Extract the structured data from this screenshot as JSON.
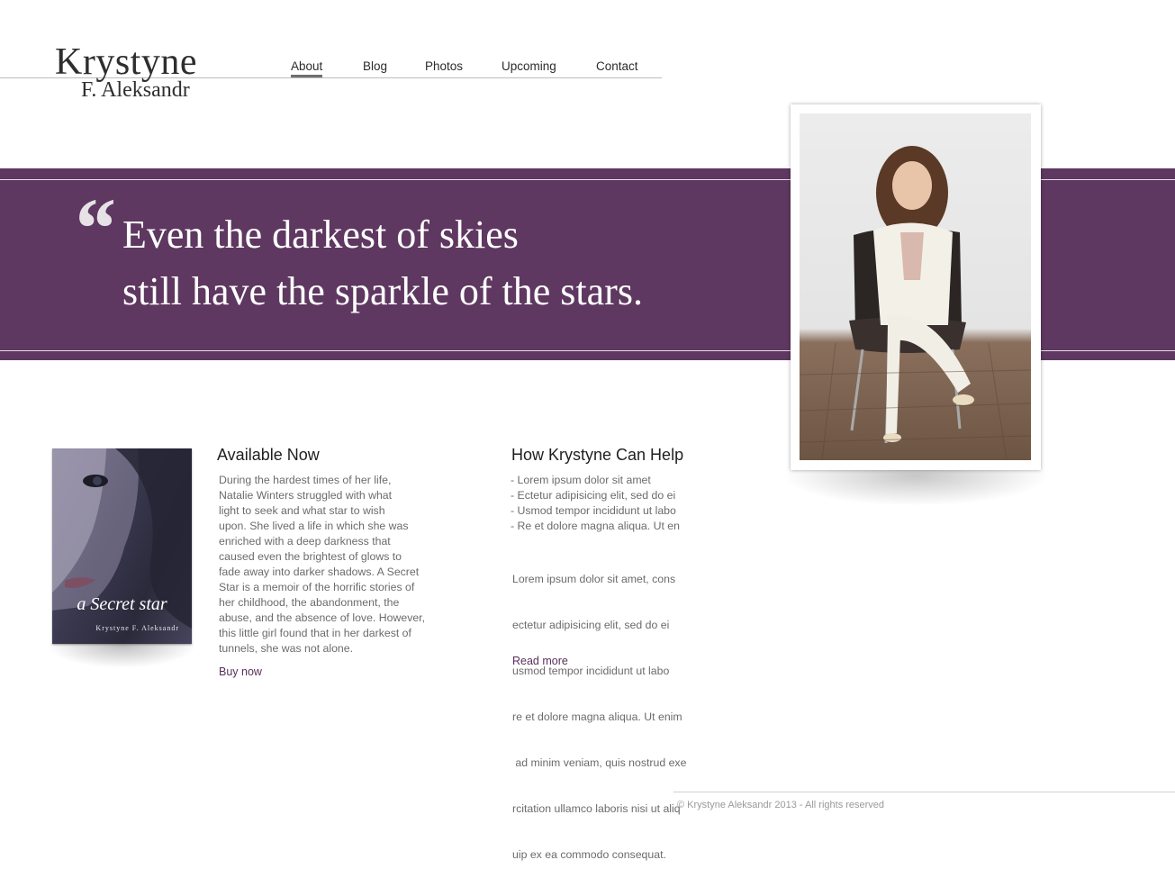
{
  "logo": {
    "line1": "Krystyne",
    "line2": "F. Aleksandr"
  },
  "nav": {
    "items": [
      {
        "label": "About",
        "active": true
      },
      {
        "label": "Blog",
        "active": false
      },
      {
        "label": "Photos",
        "active": false
      },
      {
        "label": "Upcoming",
        "active": false
      },
      {
        "label": "Contact",
        "active": false
      }
    ]
  },
  "quote": {
    "mark": "“",
    "line1": "Even the darkest of skies",
    "line2": "still have the sparkle of the stars."
  },
  "book": {
    "title": "a Secret star",
    "author": "Krystyne F. Aleksandr"
  },
  "available": {
    "title": "Available Now",
    "text": [
      "During the hardest times of her life,",
      "Natalie Winters struggled with what",
      "light to seek and what star to wish",
      "upon. She lived a life in which she was",
      "enriched with a deep darkness that",
      "caused even the brightest of glows to",
      "fade away into darker shadows. A Secret",
      "Star is a memoir of the horrific stories of",
      "her childhood, the abandonment, the",
      "abuse, and the absence of love. However,",
      "this little girl found that in her darkest of",
      "tunnels, she was not alone."
    ],
    "link": "Buy now"
  },
  "help": {
    "title": "How Krystyne Can Help",
    "bullets": [
      "- Lorem ipsum dolor sit amet",
      "- Ectetur adipisicing elit, sed do ei",
      "- Usmod tempor incididunt ut labo",
      "- Re et dolore magna aliqua. Ut en"
    ],
    "text": [
      "Lorem ipsum dolor sit amet, cons",
      "ectetur adipisicing elit, sed do ei",
      "usmod tempor incididunt ut labo",
      "re et dolore magna aliqua. Ut enim",
      " ad minim veniam, quis nostrud exe",
      "rcitation ullamco laboris nisi ut aliq",
      "uip ex ea commodo consequat."
    ],
    "link": "Read more"
  },
  "footer": {
    "text": "© Krystyne Aleksandr 2013 - All rights reserved"
  },
  "colors": {
    "banner": "#5e3860",
    "link": "#5a2f5c"
  }
}
